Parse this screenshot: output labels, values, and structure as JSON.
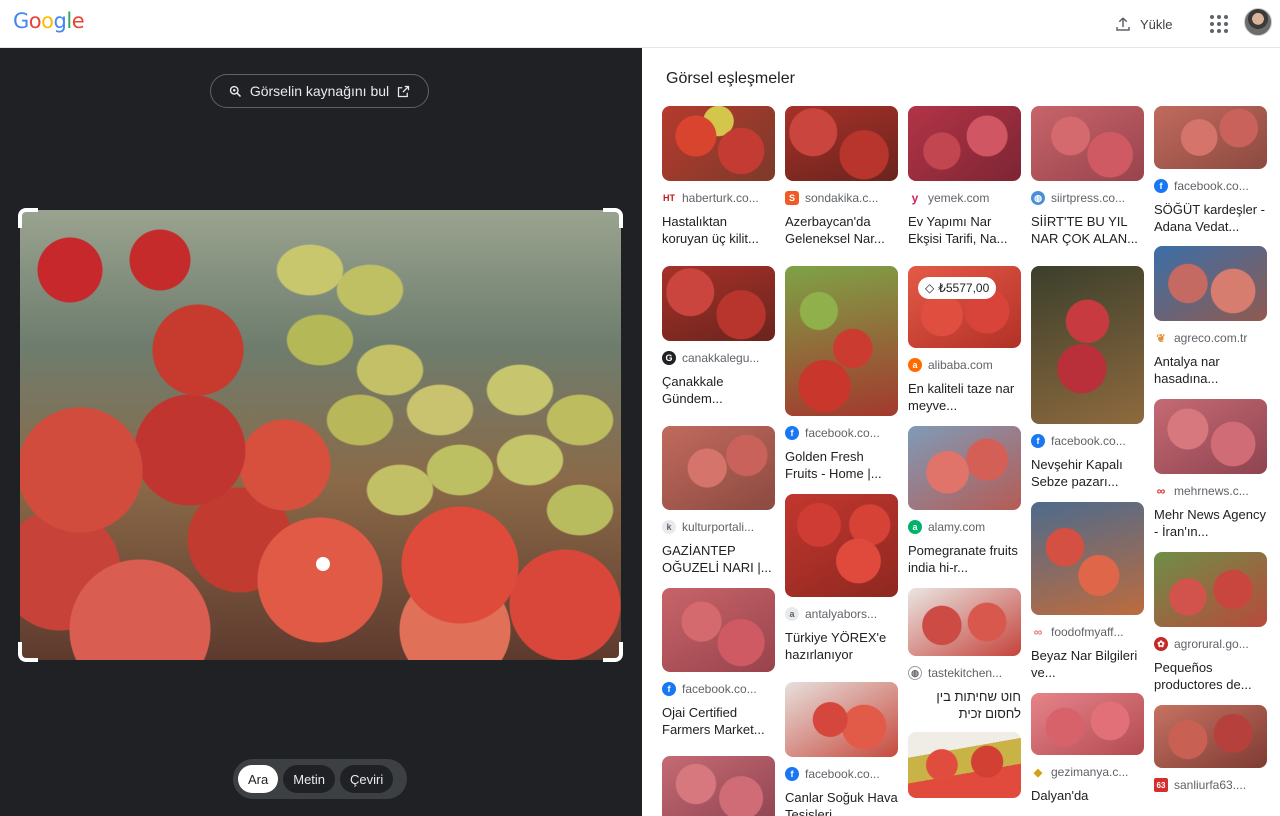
{
  "header": {
    "logo": "Google",
    "upload_label": "Yükle"
  },
  "viewer": {
    "find_source_label": "Görselin kaynağını bul",
    "modes": [
      {
        "label": "Ara",
        "active": true
      },
      {
        "label": "Metin",
        "active": false
      },
      {
        "label": "Çeviri",
        "active": false
      }
    ]
  },
  "results": {
    "title": "Görsel eşleşmeler",
    "columns": [
      [
        {
          "source": "haberturk.co...",
          "favicon": "haberturk-icon",
          "favicon_text": "HT",
          "favicon_color": "#c4161c",
          "title": "Hastalıktan koruyan üç kilit..."
        },
        {
          "source": "canakkalegu...",
          "favicon": "canakkale-icon",
          "favicon_text": "G",
          "favicon_color": "#202124",
          "title": "Çanakkale Gündem..."
        },
        {
          "source": "kulturportali...",
          "favicon": "kulturportali-icon",
          "favicon_text": "k",
          "favicon_color": "#9aa0a6",
          "title": "GAZİANTEP OĞUZELİ NARI |..."
        },
        {
          "source": "facebook.co...",
          "favicon": "facebook-icon",
          "favicon_text": "f",
          "favicon_color": "#1877f2",
          "title": "Ojai Certified Farmers Market..."
        },
        {
          "source": "",
          "favicon": "",
          "favicon_text": "",
          "favicon_color": "",
          "title": ""
        }
      ],
      [
        {
          "source": "sondakika.c...",
          "favicon": "sondakika-icon",
          "favicon_text": "S",
          "favicon_color": "#f15a24",
          "title": "Azerbaycan'da Geleneksel Nar..."
        },
        {
          "source": "facebook.co...",
          "favicon": "facebook-icon",
          "favicon_text": "f",
          "favicon_color": "#1877f2",
          "title": "Golden Fresh Fruits - Home |..."
        },
        {
          "source": "antalyabors...",
          "favicon": "antalyaborsa-icon",
          "favicon_text": "a",
          "favicon_color": "#9aa0a6",
          "title": "Türkiye YÖREX'e hazırlanıyor"
        },
        {
          "source": "facebook.co...",
          "favicon": "facebook-icon",
          "favicon_text": "f",
          "favicon_color": "#1877f2",
          "title": "Canlar Soğuk Hava Tesisleri"
        }
      ],
      [
        {
          "source": "yemek.com",
          "favicon": "yemek-icon",
          "favicon_text": "y",
          "favicon_color": "#d71a60",
          "title": "Ev Yapımı Nar Ekşisi Tarifi, Na..."
        },
        {
          "source": "alibaba.com",
          "favicon": "alibaba-icon",
          "favicon_text": "a",
          "favicon_color": "#ff6a00",
          "title": "En kaliteli taze nar meyve...",
          "price": "₺5577,00"
        },
        {
          "source": "alamy.com",
          "favicon": "alamy-icon",
          "favicon_text": "a",
          "favicon_color": "#00b26a",
          "title": "Pomegranate fruits india hi-r..."
        },
        {
          "source": "tastekitchen...",
          "favicon": "globe-icon",
          "favicon_text": "◍",
          "favicon_color": "#5f6368",
          "title": "חוט שחיתות בין לחסום זכית אומללו...",
          "rtl": true
        },
        {
          "source": "",
          "favicon": "",
          "favicon_text": "",
          "favicon_color": "",
          "title": ""
        }
      ],
      [
        {
          "source": "siirtpress.co...",
          "favicon": "siirtpress-icon",
          "favicon_text": "◍",
          "favicon_color": "#4a90d9",
          "title": "SİİRT'TE BU YIL NAR ÇOK ALAN..."
        },
        {
          "source": "facebook.co...",
          "favicon": "facebook-icon",
          "favicon_text": "f",
          "favicon_color": "#1877f2",
          "title": "Nevşehir Kapalı Sebze pazarı..."
        },
        {
          "source": "foodofmyaff...",
          "favicon": "foodofmyaffair-icon",
          "favicon_text": "∞",
          "favicon_color": "#e57373",
          "title": "Beyaz Nar Bilgileri ve..."
        },
        {
          "source": "gezimanya.c...",
          "favicon": "gezimanya-icon",
          "favicon_text": "◆",
          "favicon_color": "#d4a017",
          "title": "Dalyan'da"
        }
      ],
      [
        {
          "source": "facebook.co...",
          "favicon": "facebook-icon",
          "favicon_text": "f",
          "favicon_color": "#1877f2",
          "title": "SÖĞÜT kardeşler - Adana Vedat..."
        },
        {
          "source": "agreco.com.tr",
          "favicon": "agreco-icon",
          "favicon_text": "❦",
          "favicon_color": "#e0913a",
          "title": "Antalya nar hasadına..."
        },
        {
          "source": "mehrnews.c...",
          "favicon": "mehrnews-icon",
          "favicon_text": "∞",
          "favicon_color": "#d32f2f",
          "title": "Mehr News Agency - İran'ın..."
        },
        {
          "source": "agrorural.go...",
          "favicon": "agrorural-icon",
          "favicon_text": "✿",
          "favicon_color": "#c62828",
          "title": "Pequeños productores de..."
        },
        {
          "source": "sanliurfa63....",
          "favicon": "sanliurfa-icon",
          "favicon_text": "63",
          "favicon_color": "#d32f2f",
          "title": ""
        }
      ]
    ]
  }
}
